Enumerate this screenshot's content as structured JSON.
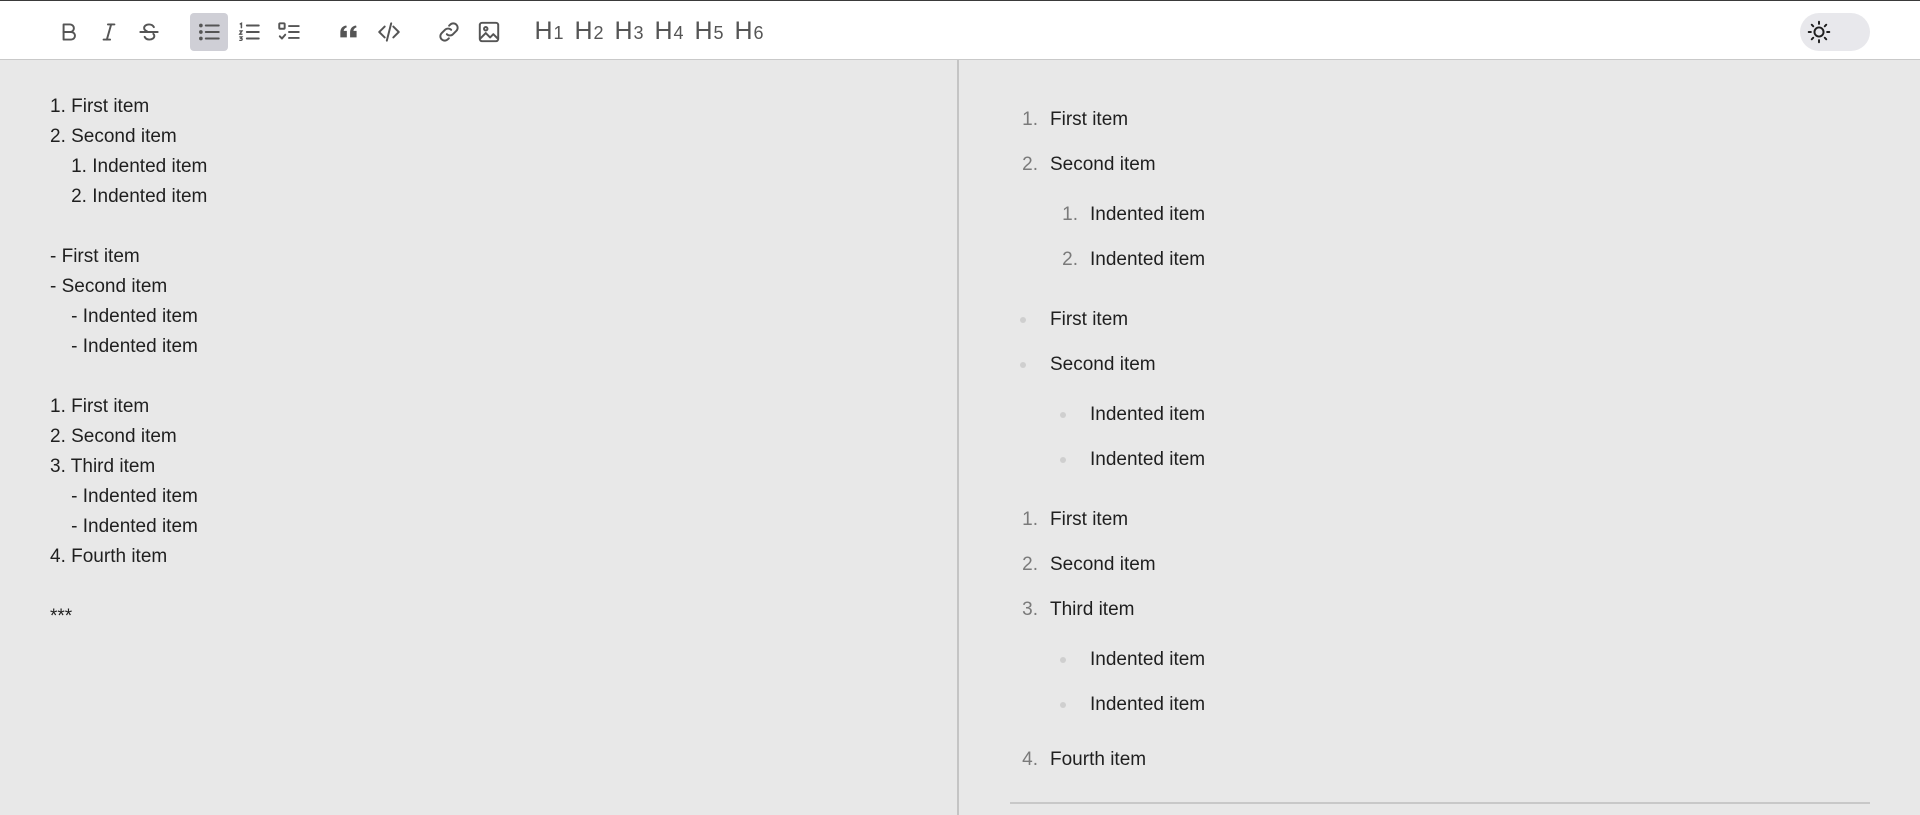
{
  "toolbar": {
    "buttons": [
      "bold",
      "italic",
      "strikethrough",
      "bullet-list",
      "numbered-list",
      "task-list",
      "quote",
      "code",
      "link",
      "image"
    ],
    "active": "bullet-list",
    "headings": [
      "1",
      "2",
      "3",
      "4",
      "5",
      "6"
    ],
    "heading_letter": "H"
  },
  "editor": {
    "lines": [
      "1. First item",
      "2. Second item",
      "    1. Indented item",
      "    2. Indented item",
      "",
      "- First item",
      "- Second item",
      "    - Indented item",
      "    - Indented item",
      "",
      "1. First item",
      "2. Second item",
      "3. Third item",
      "    - Indented item",
      "    - Indented item",
      "4. Fourth item",
      "",
      "***"
    ]
  },
  "preview": {
    "items": [
      {
        "marker": "1.",
        "text": "First item"
      },
      {
        "marker": "2.",
        "text": "Second item"
      },
      {
        "marker": "1.",
        "text": "Indented item"
      },
      {
        "marker": "2.",
        "text": "Indented item"
      },
      {
        "marker": "",
        "text": "First item"
      },
      {
        "marker": "",
        "text": "Second item"
      },
      {
        "marker": "",
        "text": "Indented item"
      },
      {
        "marker": "",
        "text": "Indented item"
      },
      {
        "marker": "1.",
        "text": "First item"
      },
      {
        "marker": "2.",
        "text": "Second item"
      },
      {
        "marker": "3.",
        "text": "Third item"
      },
      {
        "marker": "",
        "text": "Indented item"
      },
      {
        "marker": "",
        "text": "Indented item"
      },
      {
        "marker": "4.",
        "text": "Fourth item"
      }
    ]
  },
  "colors": {
    "accent": "#cfcfd6",
    "background": "#e8e8e8",
    "icon": "#555555"
  }
}
